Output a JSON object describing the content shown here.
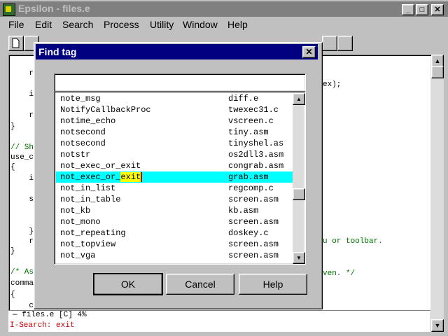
{
  "app": {
    "title": "Epsilon - files.e",
    "minimize_glyph": "_",
    "maximize_glyph": "□",
    "close_glyph": "✕"
  },
  "menu": [
    "File",
    "Edit",
    "Search",
    "Process",
    "Utility",
    "Window",
    "Help"
  ],
  "editor": {
    "lines": [
      {
        "text": "    r",
        "type": "code"
      },
      {
        "text": "    i",
        "type": "code"
      },
      {
        "text": "    r",
        "type": "code"
      },
      {
        "text": "}",
        "type": "code"
      },
      {
        "text": "// Sh",
        "type": "comment"
      },
      {
        "text": "use_c",
        "type": "code"
      },
      {
        "text": "{",
        "type": "code"
      },
      {
        "text": "    i",
        "type": "code"
      },
      {
        "text": "    s",
        "type": "code"
      },
      {
        "text": "    }",
        "type": "code"
      },
      {
        "text": "    r",
        "type": "code"
      },
      {
        "text": "}",
        "type": "code"
      },
      {
        "text": "/* As",
        "type": "comment"
      },
      {
        "text": "comma",
        "type": "code"
      },
      {
        "text": "{",
        "type": "code"
      },
      {
        "text": "    c",
        "type": "code"
      }
    ],
    "right_fragments": [
      {
        "text": "ex);",
        "type": "code"
      },
      {
        "text": "u or toolbar.",
        "type": "comment"
      },
      {
        "text": "ven. */",
        "type": "comment"
      }
    ],
    "status_line": "— files.e [C] 4%",
    "isearch": "I-Search: exit"
  },
  "dialog": {
    "title": "Find tag",
    "close_glyph": "✕",
    "input_value": "",
    "tags": [
      {
        "name": "note_msg",
        "file": "diff.e"
      },
      {
        "name": "NotifyCallbackProc",
        "file": "twexec31.c"
      },
      {
        "name": "notime_echo",
        "file": "vscreen.c"
      },
      {
        "name": "notsecond",
        "file": "tiny.asm"
      },
      {
        "name": "notsecond",
        "file": "tinyshel.as"
      },
      {
        "name": "notstr",
        "file": "os2dll3.asm"
      },
      {
        "name": "not_exec_or_exit",
        "file": "congrab.asm"
      },
      {
        "name": "not_exec_or_",
        "name_highlight": "exit",
        "file": "grab.asm",
        "selected": true
      },
      {
        "name": "not_in_list",
        "file": "regcomp.c"
      },
      {
        "name": "not_in_table",
        "file": "screen.asm"
      },
      {
        "name": "not_kb",
        "file": "kb.asm"
      },
      {
        "name": "not_mono",
        "file": "screen.asm"
      },
      {
        "name": "not_repeating",
        "file": "doskey.c"
      },
      {
        "name": "not_topview",
        "file": "screen.asm"
      },
      {
        "name": "not_vga",
        "file": "screen.asm"
      }
    ],
    "buttons": {
      "ok": "OK",
      "cancel": "Cancel",
      "help": "Help"
    }
  }
}
